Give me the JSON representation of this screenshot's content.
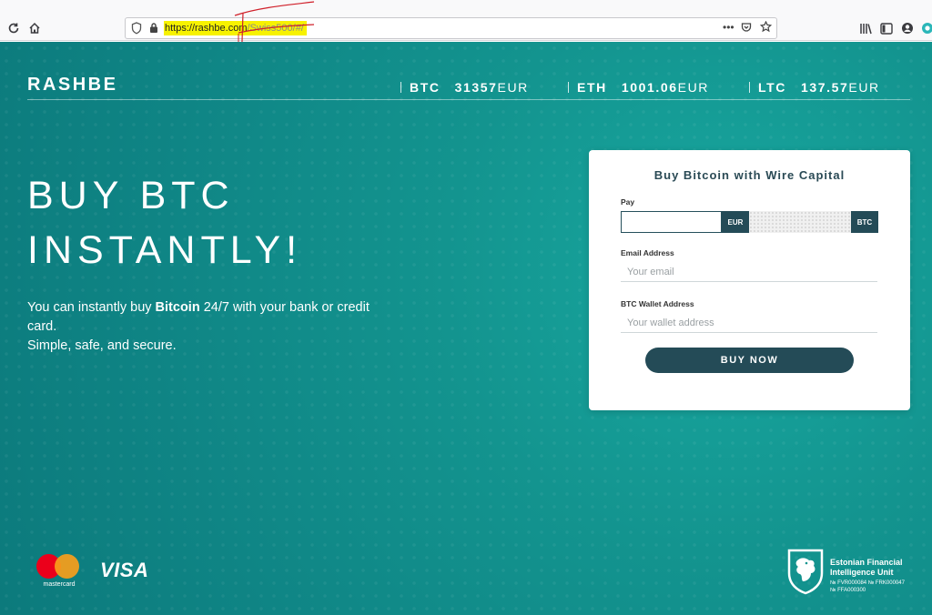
{
  "browser": {
    "url_host": "https://rashbe.com",
    "url_path": "/Swiss500/#/"
  },
  "site": {
    "brand": "RASHBE",
    "ticker": [
      {
        "symbol": "BTC",
        "value": "31357",
        "currency": "EUR"
      },
      {
        "symbol": "ETH",
        "value": "1001.06",
        "currency": "EUR"
      },
      {
        "symbol": "LTC",
        "value": "137.57",
        "currency": "EUR"
      }
    ]
  },
  "hero": {
    "line1": "BUY BTC",
    "line2": "INSTANTLY!",
    "desc_pre": "You can instantly buy ",
    "desc_bold": "Bitcoin",
    "desc_post": " 24/7 with your bank or credit card.",
    "desc_line2": "Simple, safe, and secure."
  },
  "form": {
    "title": "Buy Bitcoin with Wire Capital",
    "pay_label": "Pay",
    "pay_currency": "EUR",
    "receive_currency": "BTC",
    "email_label": "Email Address",
    "email_placeholder": "Your email",
    "wallet_label": "BTC Wallet Address",
    "wallet_placeholder": "Your wallet address",
    "buy_button": "BUY NOW"
  },
  "footer": {
    "mastercard_label": "mastercard",
    "visa_label": "VISA",
    "fiu_name": "Estonian Financial Intelligence Unit",
    "fiu_reg1": "№ FVR000084  № FRK000047",
    "fiu_reg2": "№ FFA000300"
  },
  "colors": {
    "teal_background": "#13948f",
    "dark_teal": "#244b57",
    "url_highlight": "#f7f200",
    "scribble": "#d0202a"
  },
  "icons": [
    "reload-icon",
    "home-icon",
    "shield-icon",
    "lock-icon",
    "more-icon",
    "pocket-icon",
    "bookmark-star-icon",
    "library-icon",
    "sidebar-icon",
    "account-icon",
    "extension-icon"
  ]
}
